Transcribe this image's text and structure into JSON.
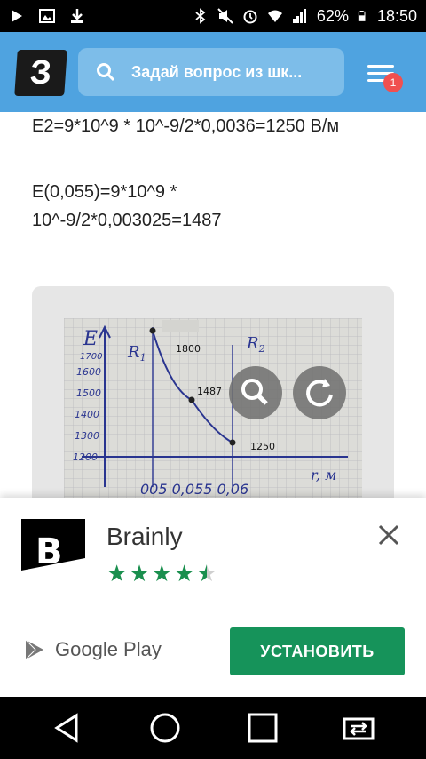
{
  "status_bar": {
    "battery": "62%",
    "time": "18:50",
    "icons": [
      "play-icon",
      "image-icon",
      "download-icon",
      "bluetooth-icon",
      "mute-icon",
      "alarm-icon",
      "wifi-icon",
      "signal-icon",
      "battery-icon"
    ]
  },
  "header": {
    "logo_text": "З",
    "search_placeholder": "Задай вопрос из шк...",
    "notification_count": "1",
    "colors": {
      "header": "#4fa3e0",
      "search": "#7dbde9",
      "badge": "#f05050"
    }
  },
  "answer": {
    "line1": "Е2=9*10^9 * 10^-9/2*0,0036=1250 В/м",
    "line2": "Е(0,055)=9*10^9 *",
    "line3": "10^-9/2*0,003025=1487"
  },
  "photo": {
    "axis_y": "E",
    "y_ticks": [
      "1700",
      "1600",
      "1500",
      "1400",
      "1300",
      "1200"
    ],
    "x_ticks": "005 0,055 0,06",
    "axis_x": "r, м",
    "label_r1": "R",
    "label_r1_sub": "1",
    "label_r2": "R",
    "label_r2_sub": "2",
    "values": [
      "1800",
      "1487",
      "1250"
    ]
  },
  "ad": {
    "app_name": "Brainly",
    "rating": 4.5,
    "store": "Google Play",
    "install_label": "УСТАНОВИТЬ",
    "colors": {
      "install": "#16935a",
      "stars": "#1a8f4e"
    }
  }
}
